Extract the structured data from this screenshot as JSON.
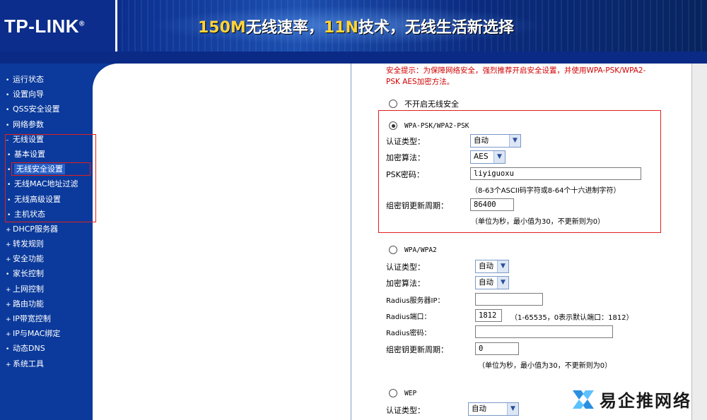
{
  "header": {
    "logo": "TP-LINK",
    "logo_mark": "®",
    "slogan_a": "150M",
    "slogan_b": "无线速率，",
    "slogan_c": "11N",
    "slogan_d": "技术，无线生活新选择"
  },
  "sidebar": {
    "items": [
      {
        "label": "运行状态",
        "bullet": "•"
      },
      {
        "label": "设置向导",
        "bullet": "•"
      },
      {
        "label": "QSS安全设置",
        "bullet": "•"
      },
      {
        "label": "网络参数",
        "bullet": "•"
      },
      {
        "label": "无线设置",
        "bullet": "–"
      },
      {
        "label": "基本设置",
        "bullet": "•"
      },
      {
        "label": "无线安全设置",
        "bullet": "•"
      },
      {
        "label": "无线MAC地址过滤",
        "bullet": "•"
      },
      {
        "label": "无线高级设置",
        "bullet": "•"
      },
      {
        "label": "主机状态",
        "bullet": "•"
      },
      {
        "label": "DHCP服务器",
        "bullet": "+"
      },
      {
        "label": "转发规则",
        "bullet": "+"
      },
      {
        "label": "安全功能",
        "bullet": "+"
      },
      {
        "label": "家长控制",
        "bullet": "•"
      },
      {
        "label": "上网控制",
        "bullet": "+"
      },
      {
        "label": "路由功能",
        "bullet": "+"
      },
      {
        "label": "IP带宽控制",
        "bullet": "+"
      },
      {
        "label": "IP与MAC绑定",
        "bullet": "+"
      },
      {
        "label": "动态DNS",
        "bullet": "•"
      },
      {
        "label": "系统工具",
        "bullet": "+"
      }
    ]
  },
  "main": {
    "warning": "安全提示：为保障网络安全，强烈推荐开启安全设置，并使用WPA-PSK/WPA2-PSK AES加密方法。",
    "none_label": "不开启无线安全",
    "psk": {
      "title": "WPA-PSK/WPA2-PSK",
      "auth_label": "认证类型：",
      "auth_value": "自动",
      "enc_label": "加密算法：",
      "enc_value": "AES",
      "key_label": "PSK密码：",
      "key_value": "liyiguoxu",
      "key_hint": "（8-63个ASCII码字符或8-64个十六进制字符）",
      "period_label": "组密钥更新周期：",
      "period_value": "86400",
      "period_hint": "（单位为秒，最小值为30，不更新则为0）"
    },
    "wpa": {
      "title": "WPA/WPA2",
      "auth_label": "认证类型：",
      "auth_value": "自动",
      "enc_label": "加密算法：",
      "enc_value": "自动",
      "radius_ip_label": "Radius服务器IP：",
      "radius_ip_value": "",
      "radius_port_label": "Radius端口：",
      "radius_port_value": "1812",
      "radius_port_hint": "（1-65535，0表示默认端口：1812）",
      "radius_pwd_label": "Radius密码：",
      "radius_pwd_value": "",
      "period_label": "组密钥更新周期：",
      "period_value": "0",
      "period_hint": "（单位为秒，最小值为30，不更新则为0）"
    },
    "wep": {
      "title": "WEP",
      "auth_label": "认证类型：",
      "auth_value": "自动"
    }
  },
  "watermark": "易企推网络",
  "colors": {
    "sidebar_bg": "#0b3a9c",
    "highlight_border": "#e02020",
    "warning_text": "#d00000"
  }
}
